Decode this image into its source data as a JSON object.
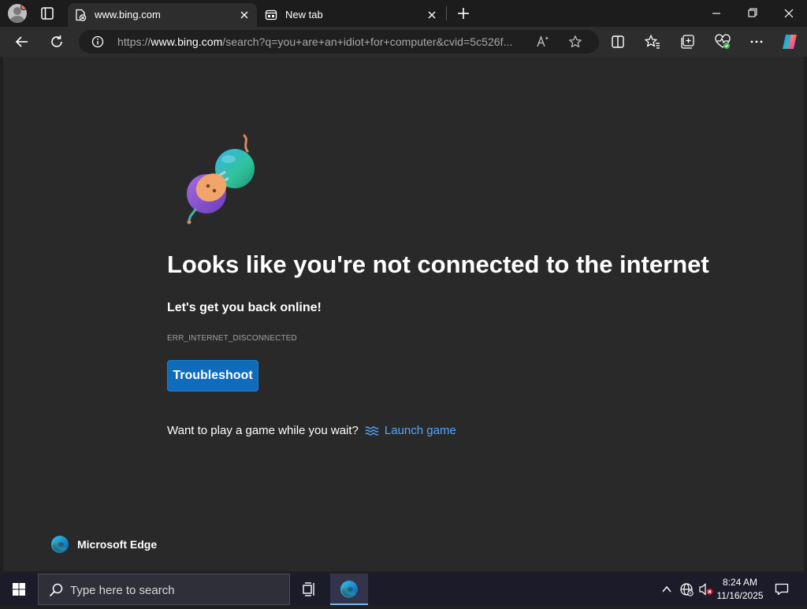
{
  "browser": {
    "tabs": [
      {
        "title": "www.bing.com",
        "active": true
      },
      {
        "title": "New tab",
        "active": false
      }
    ],
    "address": {
      "url_prefix": "https://",
      "url_domain": "www.bing.com",
      "url_rest": "/search?q=you+are+an+idiot+for+computer&cvid=5c526f..."
    }
  },
  "page": {
    "heading": "Looks like you're not connected to the internet",
    "subheading": "Let's get you back online!",
    "error_code": "ERR_INTERNET_DISCONNECTED",
    "troubleshoot_label": "Troubleshoot",
    "game_prompt": "Want to play a game while you wait?",
    "launch_game_label": "Launch game",
    "brand_name": "Microsoft Edge"
  },
  "taskbar": {
    "search_placeholder": "Type here to search",
    "time": "8:24 AM",
    "date": "11/16/2025"
  },
  "colors": {
    "accent_button": "#0f6cbd",
    "link": "#4fa8ff",
    "page_bg": "#292929"
  }
}
